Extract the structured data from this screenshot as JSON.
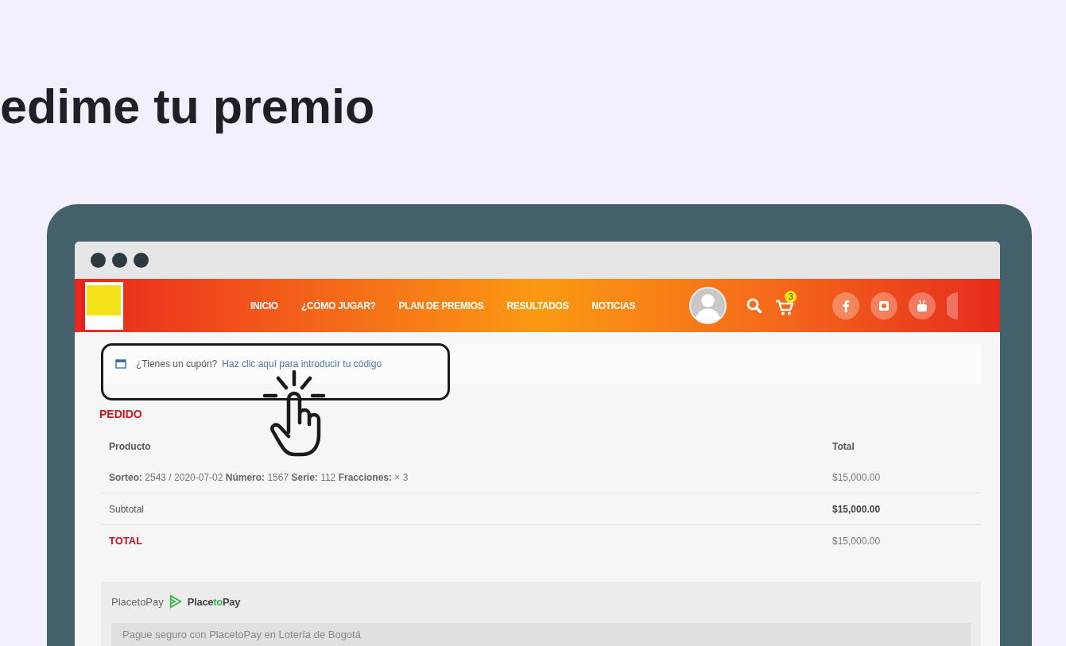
{
  "heading": "edime tu premio",
  "site": {
    "nav": [
      "INICIO",
      "¿CÓMO JUGAR?",
      "PLAN DE PREMIOS",
      "RESULTADOS",
      "NOTICIAS"
    ],
    "cart_badge": "3"
  },
  "coupon": {
    "prompt": "¿Tienes un cupón?",
    "link": "Haz clic aquí para introducir tu código"
  },
  "order": {
    "title": "PEDIDO",
    "columns": [
      "Producto",
      "Total"
    ],
    "rows": [
      {
        "kind": "item",
        "label": "**Sorteo:** 2543 / 2020-07-02 **Número:** 1567 **Serie:** 112 **Fracciones:** × 3",
        "amount": "$15,000.00"
      },
      {
        "kind": "subtotal",
        "label": "Subtotal",
        "amount": "$15,000.00"
      },
      {
        "kind": "total",
        "label": "TOTAL",
        "amount": "$15,000.00"
      }
    ]
  },
  "payment": {
    "label": "PlacetoPay",
    "logo_parts": [
      "Place",
      "to",
      "Pay"
    ],
    "notice": "Pague seguro con PlacetoPay en Lotería de Bogotá"
  }
}
